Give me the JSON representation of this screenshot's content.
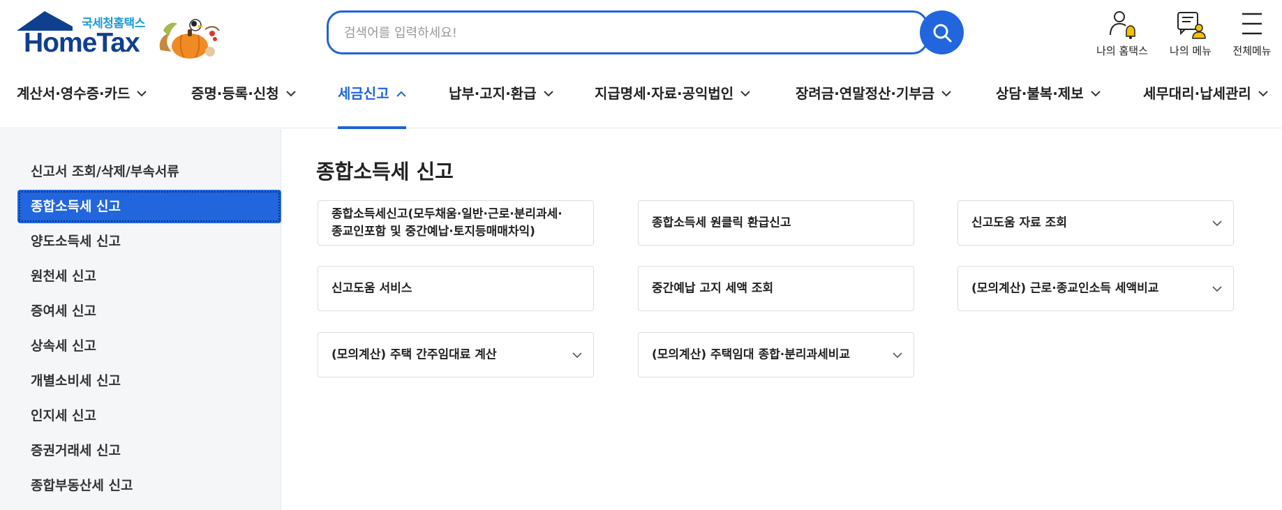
{
  "header": {
    "logo_sub": "국세청홈택스",
    "logo_main": "HomeTax",
    "search_placeholder": "검색어를 입력하세요!",
    "util": [
      {
        "label": "나의 홈택스",
        "icon": "user-bell-icon"
      },
      {
        "label": "나의 메뉴",
        "icon": "menu-user-icon"
      },
      {
        "label": "전체메뉴",
        "icon": "hamburger-icon"
      }
    ]
  },
  "gnb": {
    "items": [
      {
        "label": "계산서·영수증·카드",
        "active": false
      },
      {
        "label": "증명·등록·신청",
        "active": false
      },
      {
        "label": "세금신고",
        "active": true
      },
      {
        "label": "납부·고지·환급",
        "active": false
      },
      {
        "label": "지급명세·자료·공익법인",
        "active": false
      },
      {
        "label": "장려금·연말정산·기부금",
        "active": false
      },
      {
        "label": "상담·불복·제보",
        "active": false
      },
      {
        "label": "세무대리·납세관리",
        "active": false
      }
    ]
  },
  "sidebar": {
    "items": [
      {
        "label": "신고서 조회/삭제/부속서류"
      },
      {
        "label": "종합소득세 신고",
        "active": true
      },
      {
        "label": "양도소득세 신고"
      },
      {
        "label": "원천세 신고"
      },
      {
        "label": "증여세 신고"
      },
      {
        "label": "상속세 신고"
      },
      {
        "label": "개별소비세 신고"
      },
      {
        "label": "인지세 신고"
      },
      {
        "label": "증권거래세 신고"
      },
      {
        "label": "종합부동산세 신고"
      }
    ]
  },
  "main": {
    "title": "종합소득세 신고",
    "cards": [
      {
        "label": "종합소득세신고(모두채움·일반·근로·분리과세·종교인포함 및 중간예납·토지등매매차익)",
        "has_dropdown": false
      },
      {
        "label": "종합소득세 원클릭 환급신고",
        "has_dropdown": false
      },
      {
        "label": "신고도움 자료 조회",
        "has_dropdown": true
      },
      {
        "label": "신고도움 서비스",
        "has_dropdown": false
      },
      {
        "label": "중간예납 고지 세액 조회",
        "has_dropdown": false
      },
      {
        "label": "(모의계산) 근로·종교인소득 세액비교",
        "has_dropdown": true
      },
      {
        "label": "(모의계산) 주택 간주임대료 계산",
        "has_dropdown": true
      },
      {
        "label": "(모의계산) 주택임대 종합·분리과세비교",
        "has_dropdown": true
      }
    ]
  },
  "colors": {
    "accent": "#2266dd",
    "logo_navy": "#0f3f8f",
    "logo_sky": "#1a9ad9",
    "sidebar_bg": "#f5f6f8"
  }
}
